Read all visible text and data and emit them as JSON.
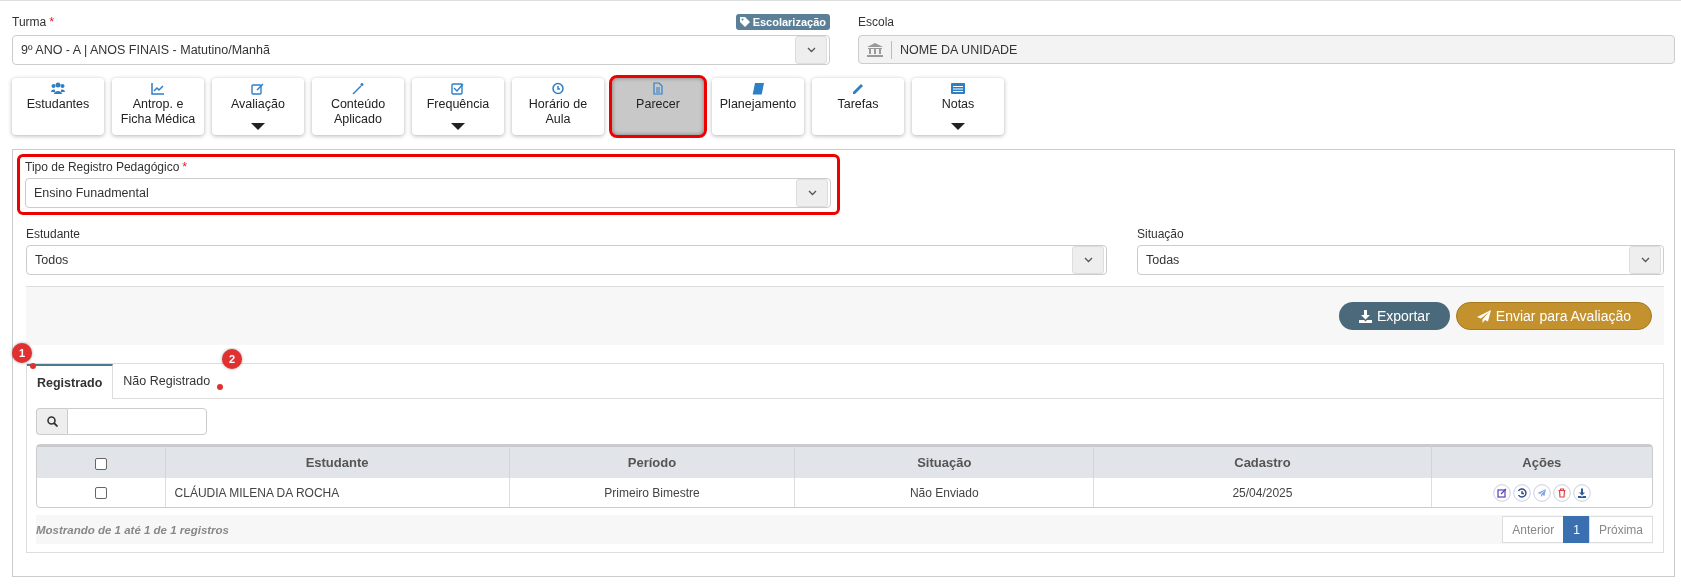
{
  "turma": {
    "label": "Turma",
    "required_mark": "*",
    "badge": "Escolarização",
    "value": "9º ANO - A | ANOS FINAIS - Matutino/Manhã"
  },
  "escola": {
    "label": "Escola",
    "value": "NOME DA UNIDADE"
  },
  "nav_buttons": [
    {
      "label": "Estudantes",
      "selected": false,
      "dropdown": false
    },
    {
      "label": "Antrop. e\nFicha Médica",
      "selected": false,
      "dropdown": false
    },
    {
      "label": "Avaliação",
      "selected": false,
      "dropdown": true
    },
    {
      "label": "Conteúdo\nAplicado",
      "selected": false,
      "dropdown": false
    },
    {
      "label": "Frequência",
      "selected": false,
      "dropdown": true
    },
    {
      "label": "Horário de\nAula",
      "selected": false,
      "dropdown": false
    },
    {
      "label": "Parecer",
      "selected": true,
      "dropdown": false
    },
    {
      "label": "Planejamento",
      "selected": false,
      "dropdown": false
    },
    {
      "label": "Tarefas",
      "selected": false,
      "dropdown": false
    },
    {
      "label": "Notas",
      "selected": false,
      "dropdown": true
    }
  ],
  "tipo_registro": {
    "label": "Tipo de Registro Pedagógico",
    "required_mark": "*",
    "value": "Ensino Funadmental"
  },
  "estudante": {
    "label": "Estudante",
    "value": "Todos"
  },
  "situacao": {
    "label": "Situação",
    "value": "Todas"
  },
  "actions": [
    {
      "label": "Exportar",
      "kind": "export"
    },
    {
      "label": "Enviar para Avaliação",
      "kind": "send"
    }
  ],
  "tabs": [
    {
      "label": "Registrado",
      "selected": true,
      "marker": "1"
    },
    {
      "label": "Não Registrado",
      "selected": false,
      "marker": "2"
    }
  ],
  "table": {
    "select_all_checked": false,
    "columns": [
      "Estudante",
      "Período",
      "Situação",
      "Cadastro",
      "Ações"
    ],
    "rows": [
      {
        "checked": false,
        "cells": [
          "CLÁUDIA MILENA DA ROCHA",
          "Primeiro Bimestre",
          "Não Enviado",
          "25/04/2025"
        ]
      }
    ]
  },
  "footer": {
    "info": "Mostrando de 1 até 1 de 1 registros",
    "prev": "Anterior",
    "pages": [
      {
        "label": "1",
        "selected": true
      }
    ],
    "next": "Próxima"
  }
}
